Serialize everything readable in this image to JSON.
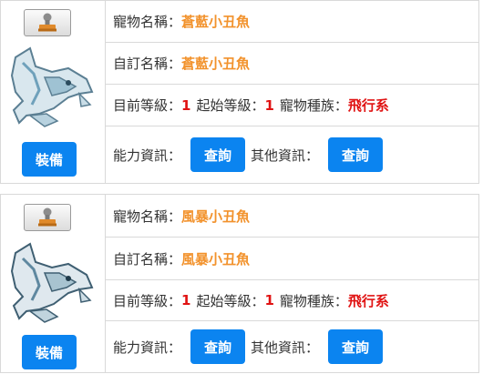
{
  "labels": {
    "pet_name": "寵物名稱：",
    "custom_name": "自訂名稱：",
    "current_level": "目前等級：",
    "start_level": "起始等級：",
    "race": "寵物種族：",
    "ability_info": "能力資訊：",
    "other_info": "其他資訊："
  },
  "pets": [
    {
      "name": "蒼藍小丑魚",
      "custom_name": "蒼藍小丑魚",
      "current_level": "1",
      "start_level": "1",
      "race": "飛行系",
      "equip_label": "裝備",
      "ability_button": "查詢",
      "other_button": "查詢",
      "stamp_icon": "stamp-icon",
      "image_icon": "pet-fish-icon"
    },
    {
      "name": "風暴小丑魚",
      "custom_name": "風暴小丑魚",
      "current_level": "1",
      "start_level": "1",
      "race": "飛行系",
      "equip_label": "裝備",
      "ability_button": "查詢",
      "other_button": "查詢",
      "stamp_icon": "stamp-icon",
      "image_icon": "pet-fish-icon"
    }
  ],
  "colors": {
    "name_accent": "#f2922c",
    "value_red": "#e01313",
    "button_blue": "#0b84f0",
    "border": "#d9d9d9"
  }
}
